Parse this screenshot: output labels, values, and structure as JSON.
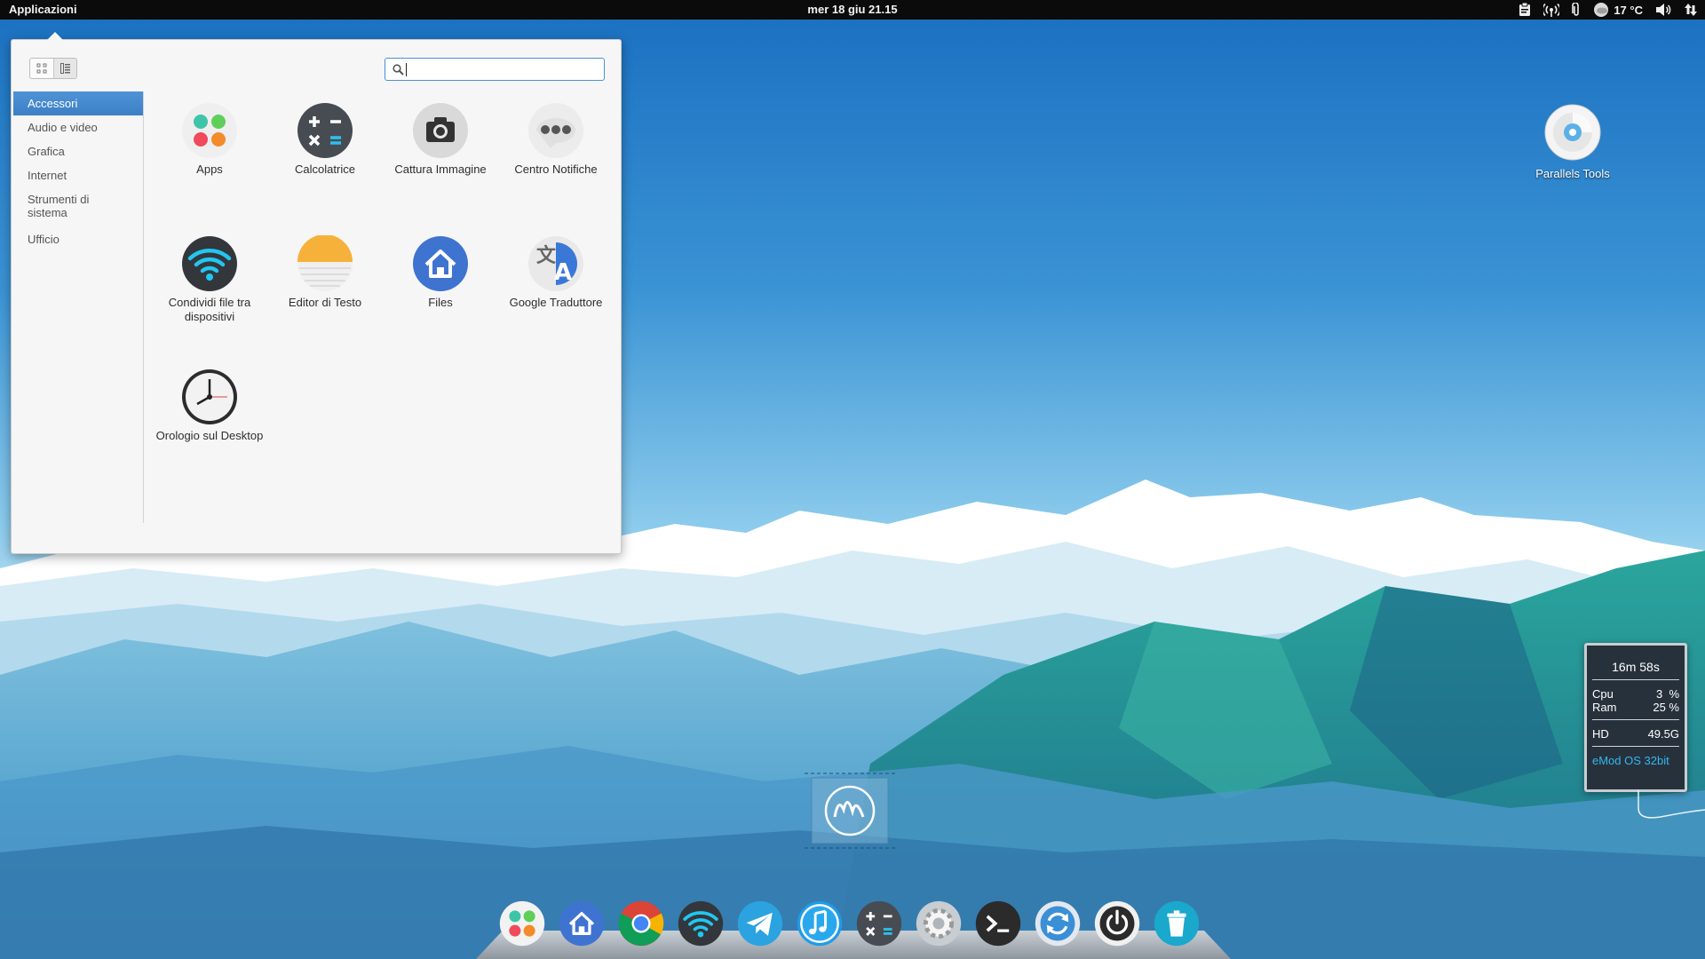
{
  "top_panel": {
    "applications_label": "Applicazioni",
    "clock": "mer 18 giu 21.15",
    "weather_temp": "17 °C",
    "indicator_icons": [
      "clipboard-icon",
      "wireless-icon",
      "paperclip-icon",
      "weather-icon",
      "volume-icon",
      "network-updown-icon"
    ]
  },
  "launcher": {
    "search": {
      "value": "",
      "placeholder": ""
    },
    "view_modes": [
      "grid-view-icon",
      "category-view-icon"
    ],
    "categories": [
      {
        "label": "Accessori",
        "selected": true
      },
      {
        "label": "Audio e video",
        "selected": false
      },
      {
        "label": "Grafica",
        "selected": false
      },
      {
        "label": "Internet",
        "selected": false
      },
      {
        "label": "Strumenti di sistema",
        "selected": false
      },
      {
        "label": "Ufficio",
        "selected": false
      }
    ],
    "apps": [
      {
        "label": "Apps",
        "icon": "apps-dots-icon"
      },
      {
        "label": "Calcolatrice",
        "icon": "calculator-icon"
      },
      {
        "label": "Cattura Immagine",
        "icon": "camera-icon"
      },
      {
        "label": "Centro Notifiche",
        "icon": "notification-bubble-icon"
      },
      {
        "label": "Condividi file tra dispositivi",
        "icon": "wifi-share-icon"
      },
      {
        "label": "Editor di Testo",
        "icon": "text-editor-icon"
      },
      {
        "label": "Files",
        "icon": "files-home-icon"
      },
      {
        "label": "Google Traduttore",
        "icon": "translate-icon"
      },
      {
        "label": "Orologio sul Desktop",
        "icon": "clock-icon"
      }
    ]
  },
  "desktop": {
    "icons": [
      {
        "label": "Parallels Tools",
        "icon": "cd-disc-icon"
      }
    ],
    "system_widget": {
      "uptime": "16m 58s",
      "cpu_label": "Cpu",
      "cpu_value": "3  %",
      "ram_label": "Ram",
      "ram_value": "25 %",
      "hd_label": "HD",
      "hd_value": "49.5G",
      "os_label": "eMod OS 32bit"
    }
  },
  "dock": {
    "items": [
      "apps-dots-icon",
      "files-home-icon",
      "chrome-icon",
      "wifi-share-icon",
      "telegram-icon",
      "music-icon",
      "calculator-icon",
      "settings-gear-icon",
      "terminal-icon",
      "update-sync-icon",
      "power-icon",
      "trash-icon"
    ]
  },
  "colors": {
    "panel_bg": "#0b0b0b",
    "selection": "#4a8ed3",
    "widget_accent": "#32b8f0",
    "sky_top": "#1d78c4"
  }
}
